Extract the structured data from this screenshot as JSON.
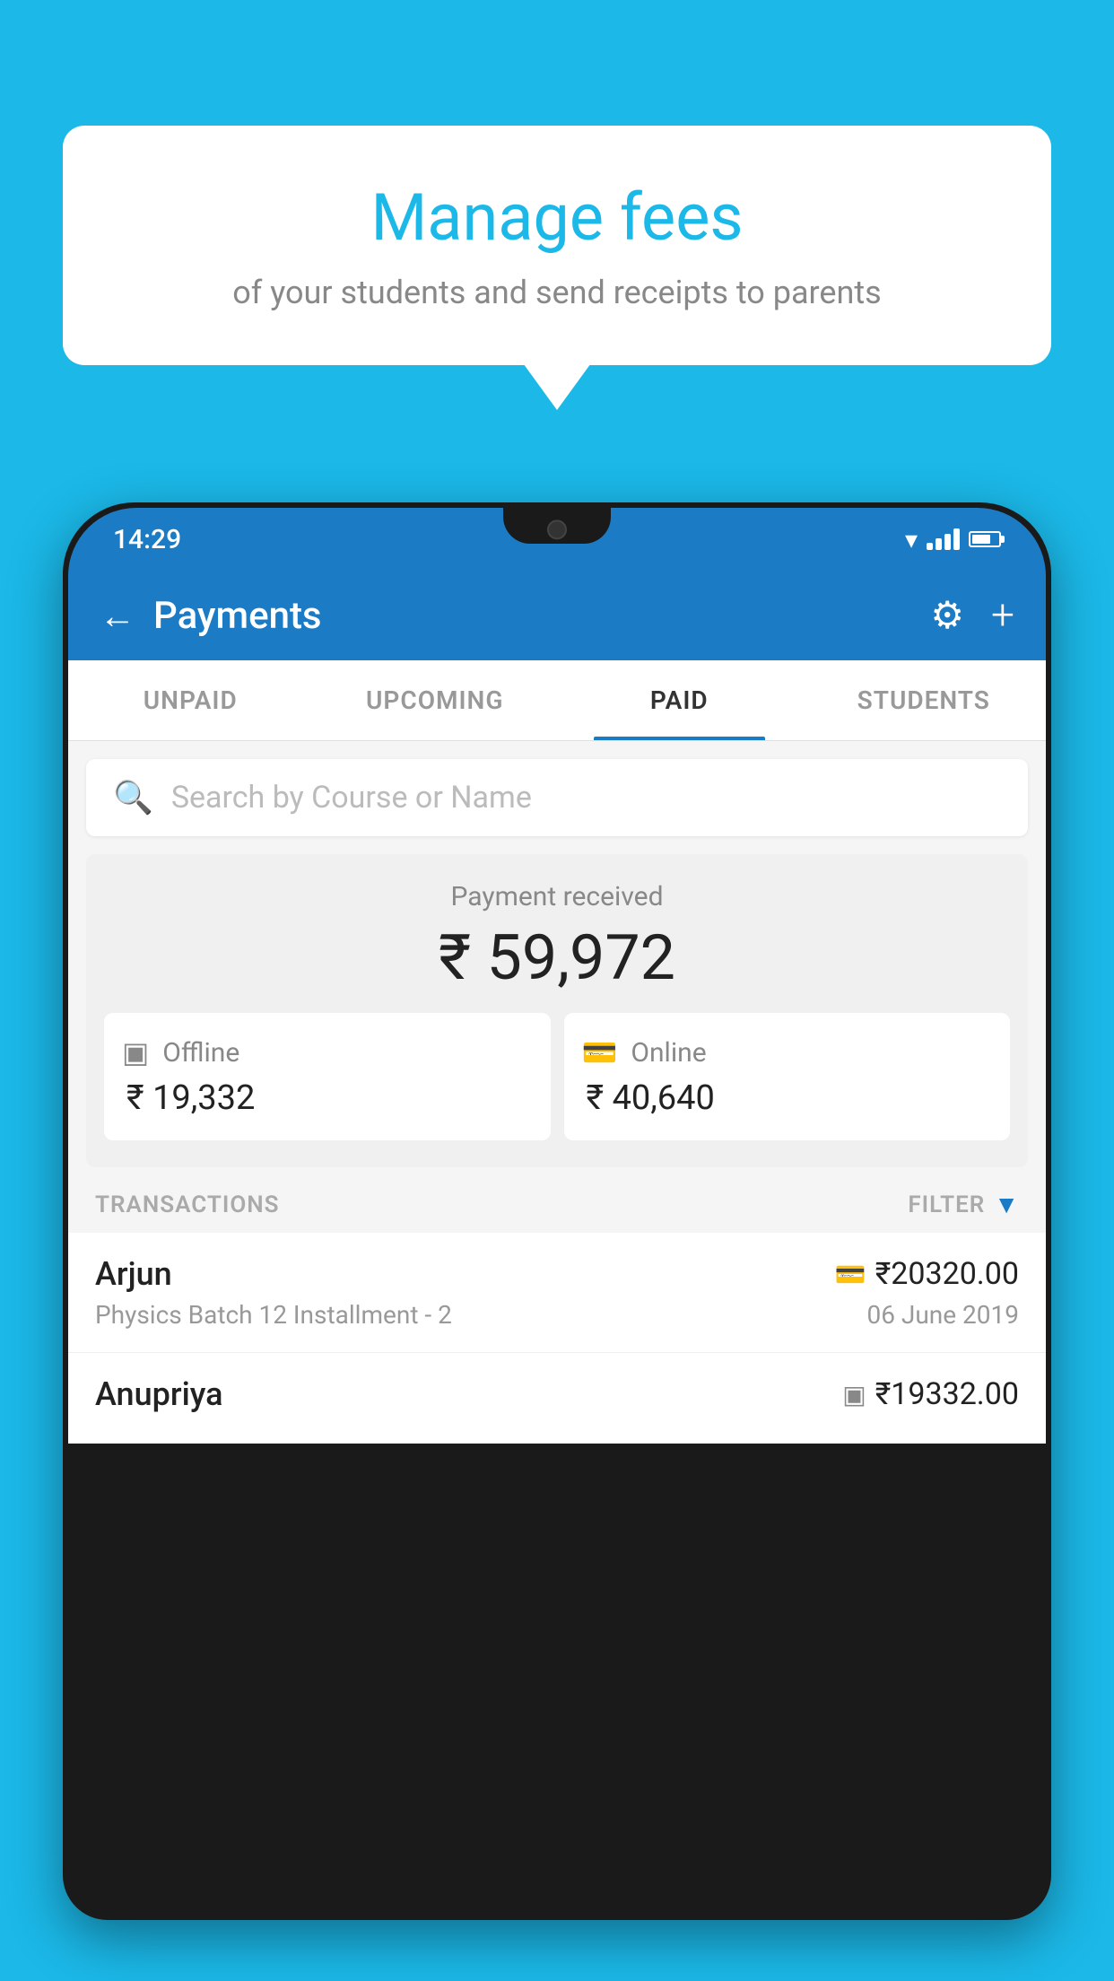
{
  "background_color": "#1bb8e8",
  "speech_bubble": {
    "title": "Manage fees",
    "subtitle": "of your students and send receipts to parents"
  },
  "phone": {
    "status_bar": {
      "time": "14:29"
    },
    "header": {
      "title": "Payments",
      "back_label": "←",
      "gear_label": "⚙",
      "plus_label": "+"
    },
    "tabs": [
      {
        "label": "UNPAID",
        "active": false
      },
      {
        "label": "UPCOMING",
        "active": false
      },
      {
        "label": "PAID",
        "active": true
      },
      {
        "label": "STUDENTS",
        "active": false
      }
    ],
    "search": {
      "placeholder": "Search by Course or Name"
    },
    "payment_section": {
      "label": "Payment received",
      "amount": "₹ 59,972",
      "offline": {
        "label": "Offline",
        "amount": "₹ 19,332"
      },
      "online": {
        "label": "Online",
        "amount": "₹ 40,640"
      }
    },
    "transactions": {
      "header_label": "TRANSACTIONS",
      "filter_label": "FILTER",
      "items": [
        {
          "name": "Arjun",
          "course": "Physics Batch 12 Installment - 2",
          "amount": "₹20320.00",
          "date": "06 June 2019",
          "payment_type": "online"
        },
        {
          "name": "Anupriya",
          "course": "",
          "amount": "₹19332.00",
          "date": "",
          "payment_type": "offline"
        }
      ]
    }
  }
}
